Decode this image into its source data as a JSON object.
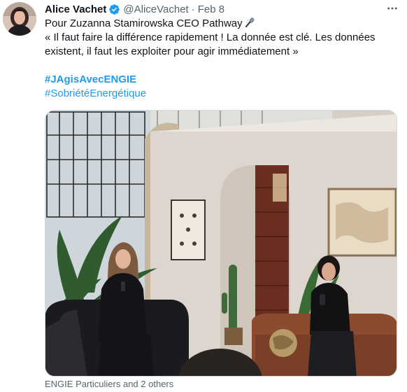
{
  "author": {
    "display_name": "Alice Vachet",
    "handle": "@AliceVachet",
    "separator": "·",
    "date": "Feb 8",
    "verified": true,
    "avatar_icon": "profile-photo"
  },
  "tweet": {
    "lines": [
      "Pour Zuzanna Stamirowska CEO Pathway",
      "« Il faut faire la différence rapidement ! La donnée est clé. Les données",
      "existent, il faut les exploiter pour agir immédiatement »"
    ],
    "emoji_icon": "microphone-icon",
    "hashtags": [
      "#JAgisAvecENGIE",
      "#SobriétéEnergétique"
    ]
  },
  "media": {
    "icon": "event-photo"
  },
  "tagged_users": "ENGIE Particuliers and 2 others",
  "more_menu_icon": "more-dots-icon",
  "colors": {
    "text": "#0f1419",
    "secondary": "#536471",
    "link": "#1d9bf0",
    "verified": "#1d9bf0",
    "border": "#cfd9de"
  }
}
